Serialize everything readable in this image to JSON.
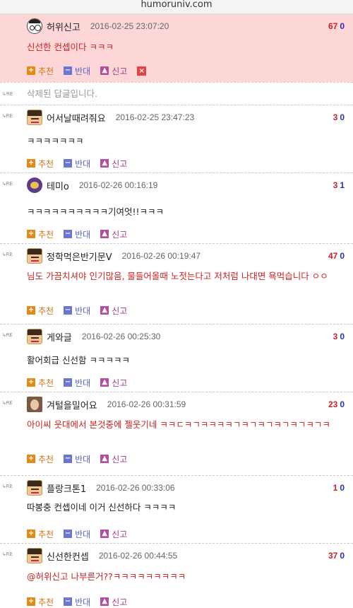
{
  "browser": {
    "url": "humoruniv.com"
  },
  "re_label": "RE",
  "actions": {
    "up": "추천",
    "down": "반대",
    "report": "신고"
  },
  "deleted_reply": "삭제된 답글입니다.",
  "comments": [
    {
      "nick": "허위신고",
      "date": "2016-02-25 23:07:20",
      "up": "67",
      "down": "0",
      "text": "신선한 컨셉이다 ㅋㅋㅋ"
    },
    {
      "nick": "어서날때려줘요",
      "date": "2016-02-25 23:47:23",
      "up": "3",
      "down": "0",
      "text": "ㅋㅋㅋㅋㅋㅋㅋ"
    },
    {
      "nick": "테미o",
      "date": "2016-02-26 00:16:19",
      "up": "3",
      "down": "1",
      "text": "ㅋㅋㅋㅋㅋㅋㅋㅋㅋㅋ기여엇!!ㅋㅋㅋ"
    },
    {
      "nick": "정학먹은반기문V",
      "date": "2016-02-26 00:19:47",
      "up": "47",
      "down": "0",
      "text": "님도 가끔치셔야 인기많음, 물들어올때 노젓는다고 저처럼 나대면 욕먹습니다 ㅇㅇ"
    },
    {
      "nick": "게와글",
      "date": "2016-02-26 00:25:30",
      "up": "3",
      "down": "0",
      "text": "활어회급 신선함 ㅋㅋㅋㅋㅋ"
    },
    {
      "nick": "겨털을밀어요",
      "date": "2016-02-26 00:31:59",
      "up": "23",
      "down": "0",
      "text": "아이씨 웃대에서 본것중에 젤웃기네 ㅋㅋㄷㅋㄱㅋㅋㅋㅋㄱㅋㄱㅋㄱㅋㄱㅋㄱㅋㄱㅋ"
    },
    {
      "nick": "플랑크톤1",
      "date": "2016-02-26 00:33:06",
      "up": "1",
      "down": "0",
      "text": "따봉충 컨셉이네 이거 신선하다 ㅋㅋㅋㅋ"
    },
    {
      "nick": "신선한컨셉",
      "date": "2016-02-26 00:44:55",
      "up": "37",
      "down": "0",
      "text": "@허위신고 나부른거??ㅋㅋㅋㅋㅋㅋㅋㅋㅋ"
    }
  ]
}
